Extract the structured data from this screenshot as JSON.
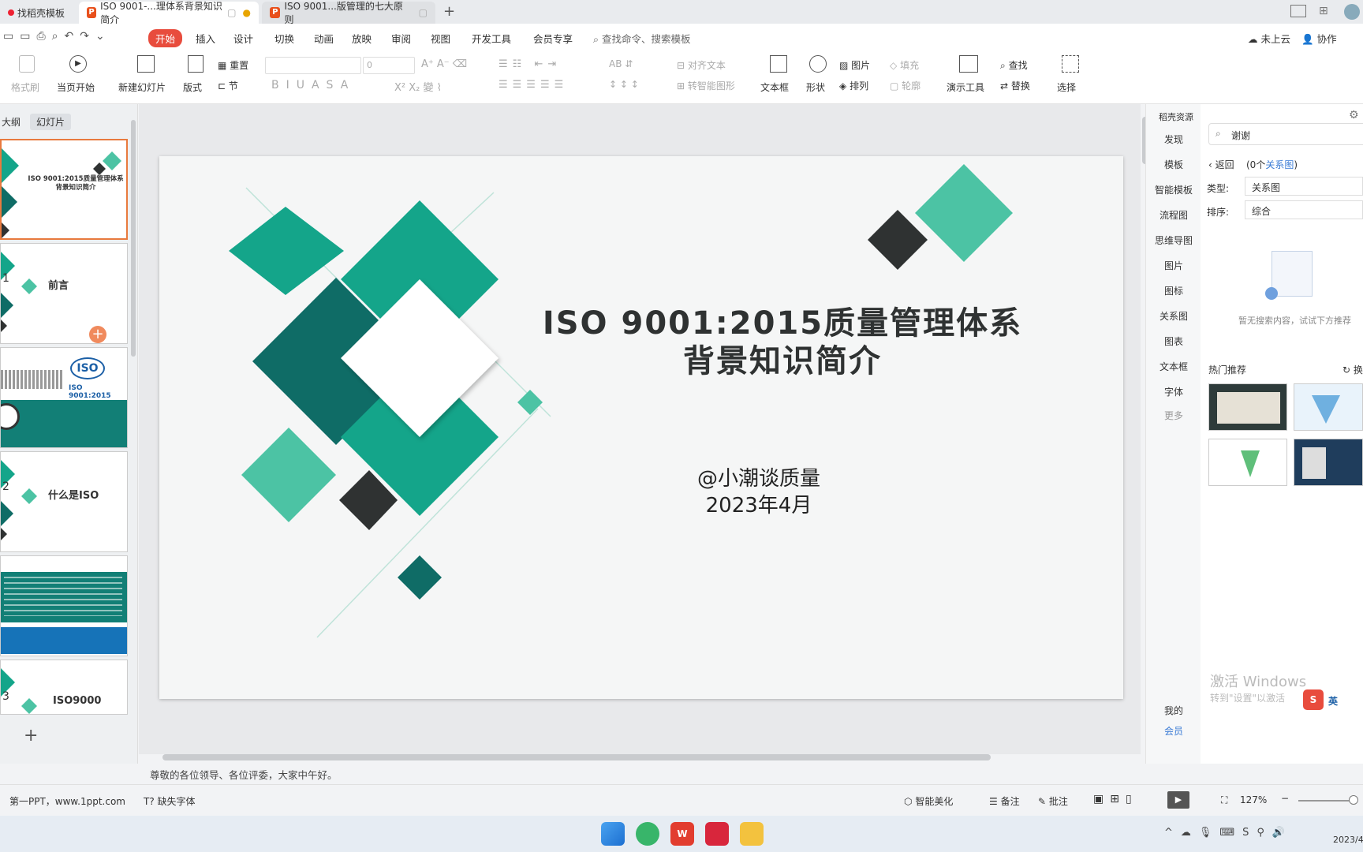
{
  "tabs": [
    {
      "label": "找稻壳模板",
      "active": false
    },
    {
      "label": "ISO 9001-...理体系背景知识简介",
      "active": true
    },
    {
      "label": "ISO 9001...版管理的七大原则",
      "active": false
    }
  ],
  "menu": {
    "items": [
      "开始",
      "插入",
      "设计",
      "切换",
      "动画",
      "放映",
      "审阅",
      "视图",
      "开发工具",
      "会员专享"
    ],
    "search_placeholder": "查找命令、搜索模板",
    "cloud": "未上云",
    "collab": "协作"
  },
  "ribbon": {
    "format_painter": "格式刷",
    "from_current": "当页开始",
    "new_slide": "新建幻灯片",
    "layout": "版式",
    "section": "节",
    "reset": "重置",
    "font_size_value": "0",
    "align_text": "对齐文本",
    "smart_shape": "转智能图形",
    "textbox": "文本框",
    "shape": "形状",
    "picture": "图片",
    "arrange": "排列",
    "fill": "填充",
    "outline": "轮廓",
    "present_tool": "演示工具",
    "find": "查找",
    "replace": "替换",
    "select": "选择"
  },
  "leftpanel": {
    "tab_outline": "大纲",
    "tab_slides": "幻灯片",
    "thumbs": [
      {
        "title": "ISO 9001:2015质量管理体系背景知识简介",
        "num": ""
      },
      {
        "title": "前言",
        "num": "1"
      },
      {
        "title": "ISO 9001:2015",
        "num": ""
      },
      {
        "title": "什么是ISO",
        "num": "2"
      },
      {
        "title": "",
        "num": ""
      },
      {
        "title": "ISO9000",
        "num": "3"
      }
    ]
  },
  "slide": {
    "title_line1": "ISO 9001:2015质量管理体系",
    "title_line2": "背景知识简介",
    "author": "@小潮谈质量",
    "date": "2023年4月"
  },
  "rightnav": {
    "header": "稻壳资源",
    "items": [
      "发现",
      "模板",
      "智能模板",
      "流程图",
      "思维导图",
      "图片",
      "图标",
      "关系图",
      "图表",
      "文本框",
      "字体",
      "更多"
    ],
    "bottom": [
      "我的",
      "会员"
    ]
  },
  "rightpane": {
    "search_value": "谢谢",
    "back": "返回",
    "result_count_prefix": "(0个",
    "result_type": "关系图",
    "result_count_suffix": ")",
    "type_label": "类型:",
    "type_value": "关系图",
    "sort_label": "排序:",
    "sort_value": "综合",
    "empty_text": "暂无搜索内容，试试下方推荐",
    "hot_title": "热门推荐",
    "refresh": "换",
    "watermark_line1": "激活 Windows",
    "watermark_line2": "转到\"设置\"以激活"
  },
  "notes": {
    "text": "尊敬的各位领导、各位评委，大家中午好。"
  },
  "statusbar": {
    "slide_info": "第一PPT，www.1ppt.com",
    "missing_font": "缺失字体",
    "beautify": "智能美化",
    "notes": "备注",
    "comment": "批注",
    "zoom": "127%"
  },
  "taskbar": {
    "date": "2023/4/"
  },
  "colors": {
    "teal_dark": "#0f6c66",
    "teal": "#14a58a",
    "teal_light": "#4cc3a4",
    "charcoal": "#2f3232",
    "accent_red": "#e84c3d"
  }
}
